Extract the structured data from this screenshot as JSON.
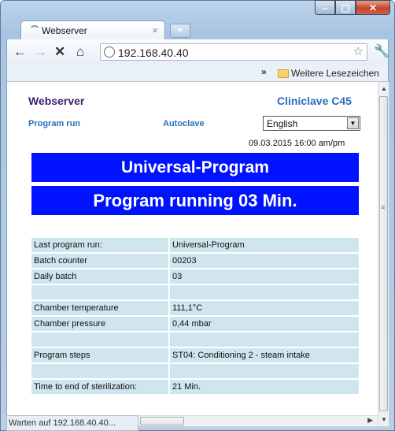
{
  "browser": {
    "tab_title": "Webserver",
    "tab_close": "×",
    "new_tab": "+",
    "url": "192.168.40.40",
    "bookmarks_more": "»",
    "bookmarks_folder": "Weitere Lesezeichen",
    "status_text": "Warten auf 192.168.40.40..."
  },
  "page": {
    "brand": "Webserver",
    "model": "Cliniclave  C45",
    "nav": [
      "Program run",
      "Autoclave"
    ],
    "language": "English",
    "datetime": "09.03.2015   16:00 am/pm",
    "banner_program": "Universal-Program",
    "banner_status": "Program running 03 Min.",
    "rows": [
      {
        "k": "Last program run:",
        "v": "Universal-Program"
      },
      {
        "k": "Batch counter",
        "v": "00203"
      },
      {
        "k": "Daily batch",
        "v": "03"
      },
      {
        "k": "",
        "v": ""
      },
      {
        "k": "Chamber temperature",
        "v": "111,1°C"
      },
      {
        "k": "Chamber pressure",
        "v": "0,44 mbar"
      },
      {
        "k": "",
        "v": ""
      },
      {
        "k": "Program steps",
        "v": "ST04: Conditioning 2 - steam intake"
      },
      {
        "k": "",
        "v": ""
      },
      {
        "k": "Time to end of sterilization:",
        "v": "21 Min."
      }
    ]
  },
  "colors": {
    "banner_bg": "#0012ff",
    "row_bg": "#cfe6ee",
    "brand": "#3a1e6e",
    "accent": "#2a6fbb"
  },
  "icons": [
    "minimize-icon",
    "maximize-icon",
    "close-icon",
    "back-icon",
    "forward-icon",
    "stop-icon",
    "home-icon",
    "globe-icon",
    "star-icon",
    "wrench-icon",
    "folder-icon"
  ]
}
